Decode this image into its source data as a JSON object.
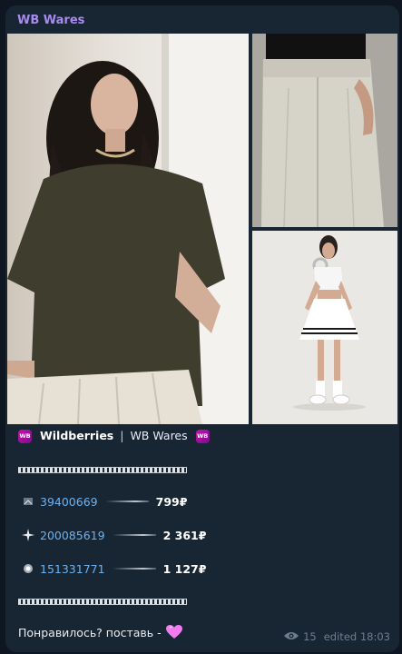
{
  "post": {
    "channel_name": "WB Wares",
    "header": {
      "badge": "WB",
      "brand": "Wildberries",
      "separator": "|",
      "channel": "WB Wares"
    },
    "items": [
      {
        "sku": "39400669",
        "price": "799₽"
      },
      {
        "sku": "200085619",
        "price": "2 361₽"
      },
      {
        "sku": "151331771",
        "price": "1 127₽"
      }
    ],
    "footer_text": "Понравилось? поставь -",
    "views": "15",
    "edited_time": "edited 18:03"
  },
  "colors": {
    "background": "#0e1621",
    "bubble": "#182533",
    "channel_name": "#a98bf0",
    "link": "#6ab3f3",
    "meta": "#6d7f8f",
    "wb_badge": "#cb11ab",
    "heart": "#f07cf0"
  },
  "icons": [
    "wb-badge-icon",
    "sparkle-icon",
    "eye-icon",
    "heart-icon"
  ]
}
